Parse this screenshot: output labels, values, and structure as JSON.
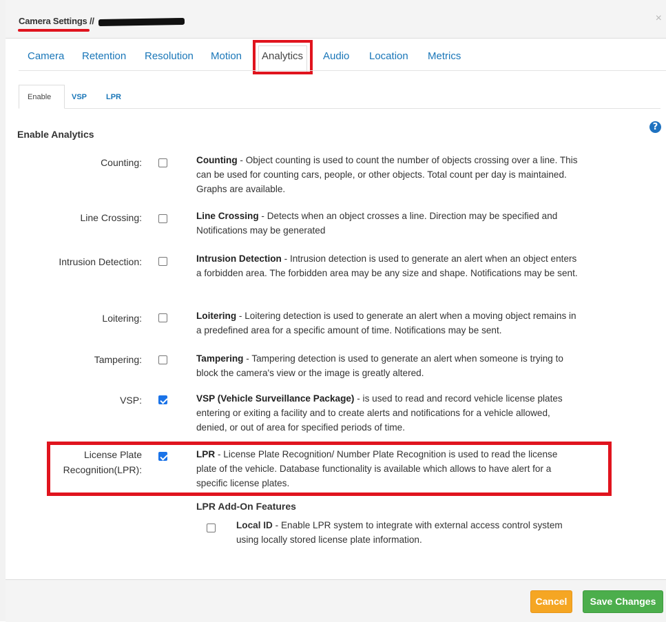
{
  "header": {
    "title": "Camera Settings //",
    "close": "×"
  },
  "tabs": [
    {
      "label": "Camera",
      "active": false
    },
    {
      "label": "Retention",
      "active": false
    },
    {
      "label": "Resolution",
      "active": false
    },
    {
      "label": "Motion",
      "active": false
    },
    {
      "label": "Analytics",
      "active": true
    },
    {
      "label": "Audio",
      "active": false
    },
    {
      "label": "Location",
      "active": false
    },
    {
      "label": "Metrics",
      "active": false
    }
  ],
  "subtabs": [
    {
      "label": "Enable",
      "active": true
    },
    {
      "label": "VSP",
      "active": false
    },
    {
      "label": "LPR",
      "active": false
    }
  ],
  "section_title": "Enable Analytics",
  "help_icon": "question-circle-icon",
  "rows": [
    {
      "label": "Counting:",
      "checked": false,
      "title": "Counting",
      "desc": " - Object counting is used to count the number of objects crossing over a line. This can be used for counting cars, people, or other objects. Total count per day is maintained. Graphs are available."
    },
    {
      "label": "Line Crossing:",
      "checked": false,
      "title": "Line Crossing",
      "desc": " - Detects when an object crosses a line. Direction may be specified and Notifications may be generated"
    },
    {
      "label": "Intrusion Detection:",
      "checked": false,
      "title": "Intrusion Detection",
      "desc": " - Intrusion detection is used to generate an alert when an object enters a forbidden area. The forbidden area may be any size and shape. Notifications may be sent."
    },
    {
      "label": "Loitering:",
      "checked": false,
      "title": "Loitering",
      "desc": " - Loitering detection is used to generate an alert when a moving object remains in a predefined area for a specific amount of time. Notifications may be sent."
    },
    {
      "label": "Tampering:",
      "checked": false,
      "title": "Tampering",
      "desc": " - Tampering detection is used to generate an alert when someone is trying to block the camera's view or the image is greatly altered."
    },
    {
      "label": "VSP:",
      "checked": true,
      "title": "VSP (Vehicle Surveillance Package)",
      "desc": " - is used to read and record vehicle license plates entering or exiting a facility and to create alerts and notifications for a vehicle allowed, denied, or out of area for specified periods of time."
    },
    {
      "label_line1": "License Plate",
      "label_line2": "Recognition(LPR):",
      "checked": true,
      "title": "LPR",
      "desc": " - License Plate Recognition/ Number Plate Recognition is used to read the license plate of the vehicle. Database functionality is available which allows to have alert for a specific license plates."
    }
  ],
  "addon": {
    "title": "LPR Add-On Features",
    "checked": false,
    "item_title": "Local ID",
    "item_desc": " - Enable LPR system to integrate with external access control system using locally stored license plate information."
  },
  "footer": {
    "cancel_label": "Cancel",
    "save_label": "Save Changes"
  },
  "colors": {
    "link": "#1976b8",
    "highlight_red": "#e0141e",
    "cancel": "#f5a623",
    "save": "#4cae4c",
    "checkbox_checked": "#1a73e8"
  }
}
